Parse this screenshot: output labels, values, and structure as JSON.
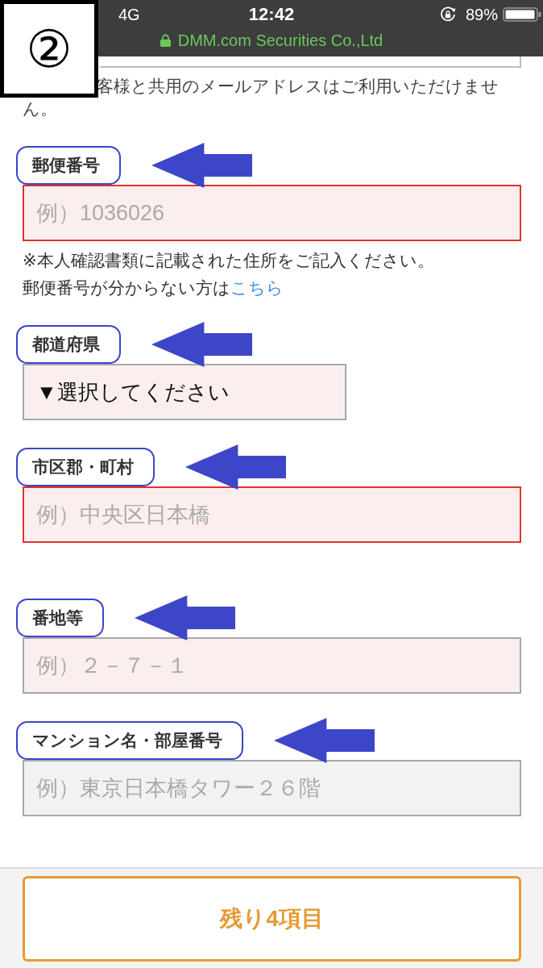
{
  "status_bar": {
    "network": "4G",
    "time": "12:42",
    "battery": "89%"
  },
  "address_bar": {
    "site": "DMM.com Securities Co.,Ltd"
  },
  "step_badge": "②",
  "email_notice": "客様と共用のメールアドレスはご利用いただけません。",
  "fields": [
    {
      "label": "郵便番号",
      "kind": "text",
      "placeholder": "例）1036026",
      "required": true,
      "error": true,
      "highlighted": true,
      "notes": [
        {
          "text": "※本人確認書類に記載された住所をご記入ください。"
        },
        {
          "text": "郵便番号が分からない方は",
          "link": "こちら"
        }
      ]
    },
    {
      "label": "都道府県",
      "kind": "select",
      "value": "▼選択してください",
      "required": true,
      "error": false,
      "highlighted": true
    },
    {
      "label": "市区郡・町村",
      "kind": "text",
      "placeholder": "例）中央区日本橋",
      "required": true,
      "error": true,
      "highlighted": true
    },
    {
      "label": "番地等",
      "kind": "text",
      "placeholder": "例）２－７－１",
      "required": true,
      "error": false,
      "highlighted": true
    },
    {
      "label": "マンション名・部屋番号",
      "kind": "text",
      "placeholder": "例）東京日本橋タワー２６階",
      "required": false,
      "error": false,
      "highlighted": true
    }
  ],
  "footer_button": {
    "label": "残り4項目"
  }
}
